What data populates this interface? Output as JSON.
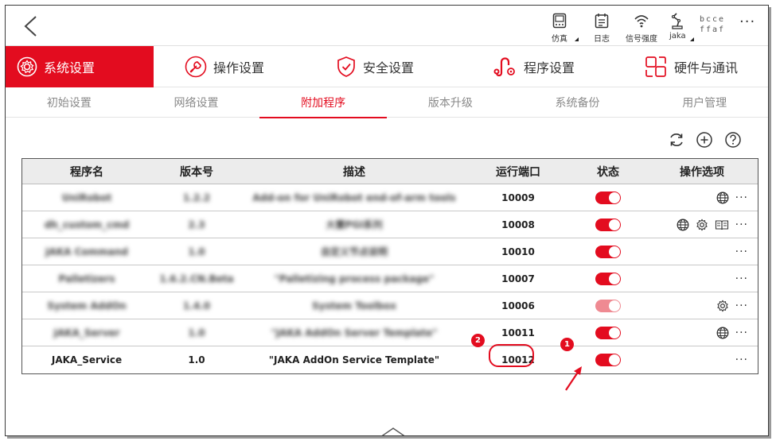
{
  "status_bar": {
    "items": [
      {
        "icon": "simulation-icon",
        "label": "仿真"
      },
      {
        "icon": "calendar-log-icon",
        "label": "日志"
      },
      {
        "icon": "wifi-icon",
        "label": "信号强度"
      },
      {
        "icon": "robot-arm-icon",
        "label": "jaka"
      }
    ],
    "user_code_line1": "bcce",
    "user_code_line2": "ffaf",
    "more": "···"
  },
  "main_tabs": [
    {
      "label": "系统设置",
      "icon": "settings-gear-icon",
      "active": true
    },
    {
      "label": "操作设置",
      "icon": "wrench-icon",
      "active": false
    },
    {
      "label": "安全设置",
      "icon": "shield-check-icon",
      "active": false
    },
    {
      "label": "程序设置",
      "icon": "program-settings-icon",
      "active": false
    },
    {
      "label": "硬件与通讯",
      "icon": "hardware-comm-icon",
      "active": false
    }
  ],
  "sub_tabs": [
    {
      "label": "初始设置",
      "active": false
    },
    {
      "label": "网络设置",
      "active": false
    },
    {
      "label": "附加程序",
      "active": true
    },
    {
      "label": "版本升级",
      "active": false
    },
    {
      "label": "系统备份",
      "active": false
    },
    {
      "label": "用户管理",
      "active": false
    }
  ],
  "toolbar": {
    "refresh_icon": "refresh-icon",
    "add_icon": "add-circle-icon",
    "help_icon": "help-circle-icon"
  },
  "table": {
    "headers": {
      "name": "程序名",
      "version": "版本号",
      "description": "描述",
      "port": "运行端口",
      "state": "状态",
      "ops": "操作选项"
    },
    "rows": [
      {
        "name": "UniRobot",
        "version": "1.2.2",
        "description": "Add-on for UniRobot end-of-arm tools",
        "port": "10009",
        "enabled": true,
        "ops": [
          "globe"
        ],
        "blurred": true
      },
      {
        "name": "dh_custom_cmd",
        "version": "2.3",
        "description": "大寰PGI系列",
        "port": "10008",
        "enabled": true,
        "ops": [
          "globe",
          "gear",
          "book"
        ],
        "blurred": true
      },
      {
        "name": "JAKA Command",
        "version": "1.0",
        "description": "自定义节点说明",
        "port": "10010",
        "enabled": true,
        "ops": [],
        "blurred": true
      },
      {
        "name": "Palletizers",
        "version": "1.6.2.CN.Beta",
        "description": "\"Palletizing process package\"",
        "port": "10007",
        "enabled": true,
        "ops": [],
        "blurred": true
      },
      {
        "name": "System AddOn",
        "version": "1.4.0",
        "description": "System Toolbox",
        "port": "10006",
        "enabled": false,
        "ops": [
          "gear"
        ],
        "blurred": true
      },
      {
        "name": "JAKA_Server",
        "version": "1.0",
        "description": "\"JAKA AddOn Server Template\"",
        "port": "10011",
        "enabled": true,
        "ops": [
          "globe"
        ],
        "blurred": true
      },
      {
        "name": "JAKA_Service",
        "version": "1.0",
        "description": "\"JAKA AddOn Service Template\"",
        "port": "10012",
        "enabled": true,
        "ops": [],
        "blurred": false
      }
    ],
    "more": "···"
  },
  "annotations": {
    "badge_toggle": "1",
    "badge_port": "2"
  },
  "colors": {
    "accent": "#e30c1f",
    "toggle_faded": "#ef8a92"
  }
}
